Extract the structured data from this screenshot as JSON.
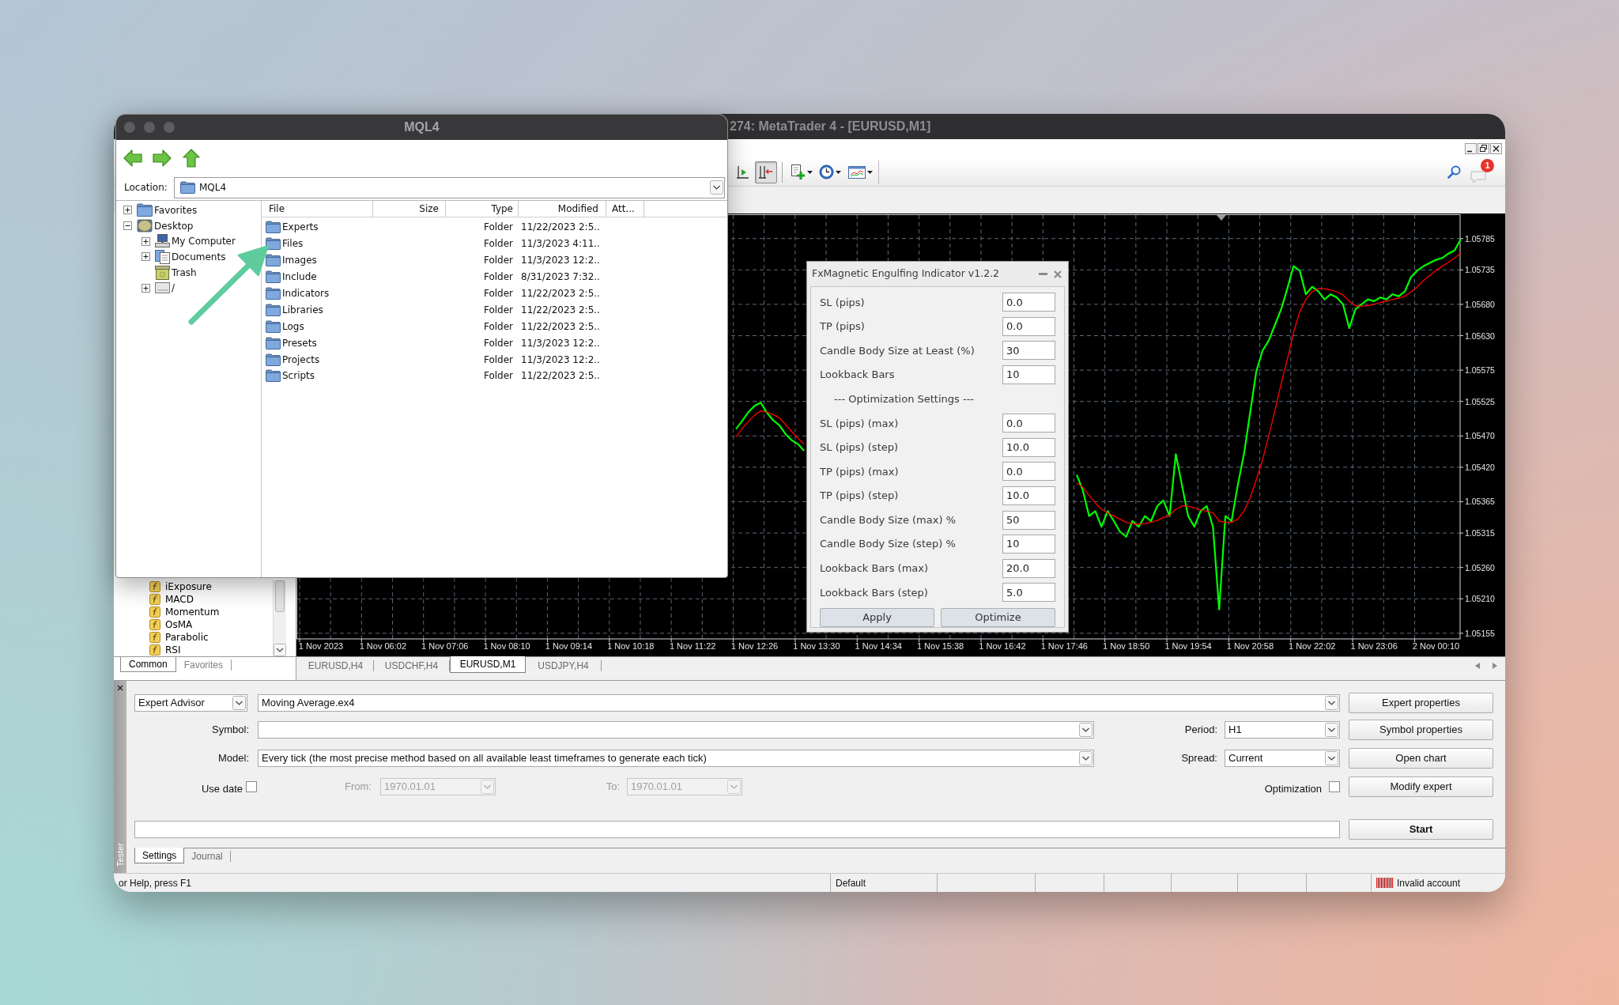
{
  "file_browser": {
    "title": "MQL4",
    "location_label": "Location:",
    "location": "MQL4",
    "tree": [
      {
        "kind": "favorites",
        "label": "Favorites",
        "expanded": false
      },
      {
        "kind": "desktop",
        "label": "Desktop",
        "expanded": true,
        "children": [
          {
            "kind": "computer",
            "label": "My Computer",
            "expanded": false
          },
          {
            "kind": "documents",
            "label": "Documents",
            "expanded": false
          },
          {
            "kind": "trash",
            "label": "Trash"
          },
          {
            "kind": "drive",
            "label": "/",
            "expanded": false
          }
        ]
      }
    ],
    "columns": [
      "File",
      "Size",
      "Type",
      "Modified",
      "Att..."
    ],
    "rows": [
      {
        "name": "Experts",
        "type": "Folder",
        "modified": "11/22/2023 2:5.."
      },
      {
        "name": "Files",
        "type": "Folder",
        "modified": "11/3/2023 4:11.."
      },
      {
        "name": "Images",
        "type": "Folder",
        "modified": "11/3/2023 12:2.."
      },
      {
        "name": "Include",
        "type": "Folder",
        "modified": "8/31/2023 7:32.."
      },
      {
        "name": "Indicators",
        "type": "Folder",
        "modified": "11/22/2023 2:5.."
      },
      {
        "name": "Libraries",
        "type": "Folder",
        "modified": "11/22/2023 2:5.."
      },
      {
        "name": "Logs",
        "type": "Folder",
        "modified": "11/22/2023 2:5.."
      },
      {
        "name": "Presets",
        "type": "Folder",
        "modified": "11/3/2023 12:2.."
      },
      {
        "name": "Projects",
        "type": "Folder",
        "modified": "11/3/2023 12:2.."
      },
      {
        "name": "Scripts",
        "type": "Folder",
        "modified": "11/22/2023 2:5.."
      }
    ]
  },
  "main_window": {
    "title": "274: MetaTrader 4 - [EURUSD,M1]"
  },
  "toolbar": {
    "buttons": [
      {
        "kind": "chart_shift",
        "pressed": false
      },
      {
        "kind": "auto_scroll",
        "pressed": true
      },
      {
        "kind": "separator"
      },
      {
        "kind": "new_chart",
        "pressed": false
      },
      {
        "kind": "periods",
        "pressed": false
      },
      {
        "kind": "templates",
        "pressed": false
      }
    ],
    "notification_count": "1"
  },
  "navigator": {
    "items": [
      "iExposure",
      "MACD",
      "Momentum",
      "OsMA",
      "Parabolic",
      "RSI"
    ],
    "tabs": [
      {
        "label": "Common",
        "selected": true
      },
      {
        "label": "Favorites",
        "selected": false
      }
    ]
  },
  "chart": {
    "chart_data": {
      "type": "line",
      "grid": true,
      "categories": [
        "1 Nov 2023",
        null,
        null,
        null,
        null,
        null,
        null,
        null,
        null,
        null,
        "1 Nov 06:02",
        null,
        null,
        null,
        null,
        null,
        null,
        null,
        null,
        null,
        "1 Nov 07:06",
        null,
        null,
        null,
        null,
        null,
        null,
        null,
        null,
        null,
        "1 Nov 08:10",
        null,
        null,
        null,
        null,
        null,
        null,
        null,
        null,
        null,
        "1 Nov 09:14",
        null,
        null,
        null,
        null,
        null,
        null,
        null,
        null,
        null,
        "1 Nov 10:18",
        null,
        null,
        null,
        null,
        null,
        null,
        null,
        null,
        null,
        "1 Nov 11:22",
        null,
        null,
        null,
        null,
        null,
        null,
        null,
        null,
        null,
        "1 Nov 12:26",
        null,
        null,
        null,
        null,
        null,
        null,
        null,
        null,
        null,
        "1 Nov 13:30",
        null,
        null,
        null,
        null,
        null,
        null,
        null,
        null,
        null,
        "1 Nov 14:34",
        null,
        null,
        null,
        null,
        null,
        null,
        null,
        null,
        null,
        "1 Nov 15:38",
        null,
        null,
        null,
        null,
        null,
        null,
        null,
        null,
        null,
        "1 Nov 16:42",
        null,
        null,
        null,
        null,
        null,
        null,
        null,
        null,
        null,
        "1 Nov 17:46",
        null,
        null,
        null,
        null,
        null,
        null,
        null,
        null,
        null,
        "1 Nov 18:50",
        null,
        null,
        null,
        null,
        null,
        null,
        null,
        null,
        null,
        "1 Nov 19:54",
        null,
        null,
        null,
        null,
        null,
        null,
        null,
        null,
        null,
        "1 Nov 20:58",
        null,
        null,
        null,
        null,
        null,
        null,
        null,
        null,
        null,
        "1 Nov 22:02",
        null,
        null,
        null,
        null,
        null,
        null,
        null,
        null,
        null,
        "1 Nov 23:06",
        null,
        null,
        null,
        null,
        null,
        null,
        null,
        null,
        null,
        "2 Nov 00:10",
        null,
        null,
        null,
        null
      ],
      "series": [
        {
          "color": "#00ff00",
          "values": [
            null,
            null,
            null,
            null,
            null,
            null,
            null,
            null,
            null,
            null,
            null,
            null,
            null,
            null,
            null,
            null,
            null,
            null,
            null,
            null,
            null,
            null,
            null,
            null,
            null,
            null,
            null,
            null,
            null,
            null,
            null,
            null,
            null,
            null,
            null,
            null,
            null,
            null,
            null,
            null,
            null,
            null,
            null,
            null,
            null,
            null,
            null,
            null,
            null,
            null,
            null,
            null,
            null,
            null,
            null,
            null,
            null,
            null,
            null,
            null,
            null,
            null,
            null,
            null,
            null,
            null,
            null,
            1.05481,
            1.05494,
            1.05508,
            1.05518,
            1.05523,
            1.05507,
            1.05495,
            1.05487,
            1.05473,
            1.05463,
            1.05457,
            1.05446,
            null,
            null,
            null,
            null,
            null,
            null,
            null,
            null,
            null,
            null,
            null,
            null,
            null,
            null,
            null,
            null,
            null,
            null,
            null,
            null,
            null,
            null,
            null,
            null,
            null,
            null,
            null,
            null,
            null,
            null,
            null,
            null,
            null,
            null,
            null,
            null,
            null,
            null,
            null,
            null,
            null,
            null,
            null,
            1.05408,
            1.05383,
            1.05342,
            1.0535,
            1.05325,
            1.0535,
            1.05334,
            1.05317,
            1.05309,
            1.05334,
            1.05325,
            1.05342,
            1.05334,
            1.05358,
            1.05367,
            1.05342,
            1.05441,
            1.05391,
            1.05342,
            1.05325,
            1.0535,
            1.05358,
            1.05325,
            1.05193,
            1.05342,
            1.05334,
            1.05391,
            1.05441,
            1.05507,
            1.05573,
            1.05606,
            1.05622,
            1.05647,
            1.05672,
            1.05705,
            1.05741,
            1.05734,
            1.05696,
            1.05708,
            1.05701,
            1.05688,
            1.05696,
            1.05691,
            1.0568,
            1.05642,
            1.05672,
            1.0568,
            1.05688,
            1.05685,
            1.05691,
            1.05688,
            1.05696,
            1.05693,
            1.05701,
            1.05724,
            1.05734,
            1.05741,
            1.05746,
            1.05751,
            1.05754,
            1.05761,
            1.05766,
            1.05784
          ]
        },
        {
          "color": "#ff0000",
          "values": [
            null,
            null,
            null,
            null,
            null,
            null,
            null,
            null,
            null,
            null,
            null,
            null,
            null,
            null,
            null,
            null,
            null,
            null,
            null,
            null,
            null,
            null,
            null,
            null,
            null,
            null,
            null,
            null,
            null,
            null,
            null,
            null,
            null,
            null,
            null,
            null,
            null,
            null,
            null,
            null,
            null,
            null,
            null,
            null,
            null,
            null,
            null,
            null,
            null,
            null,
            null,
            null,
            null,
            null,
            null,
            null,
            null,
            null,
            null,
            null,
            null,
            null,
            null,
            null,
            null,
            null,
            null,
            1.05468,
            1.05482,
            1.05493,
            1.05503,
            1.0551,
            1.05508,
            1.05504,
            1.05499,
            1.05488,
            1.05477,
            1.05466,
            1.05457,
            null,
            null,
            null,
            null,
            null,
            null,
            null,
            null,
            null,
            null,
            null,
            null,
            null,
            null,
            null,
            null,
            null,
            null,
            null,
            null,
            null,
            null,
            null,
            null,
            null,
            null,
            null,
            null,
            null,
            null,
            null,
            null,
            null,
            null,
            null,
            null,
            null,
            null,
            null,
            null,
            null,
            null,
            null,
            1.05395,
            1.05388,
            1.05375,
            1.05363,
            1.05353,
            1.05347,
            1.05342,
            1.05337,
            1.05332,
            1.0533,
            1.05329,
            1.0533,
            1.05332,
            1.05335,
            1.0534,
            1.05343,
            1.05353,
            1.05358,
            1.05358,
            1.05355,
            1.05352,
            1.0535,
            1.05347,
            1.05334,
            1.05332,
            1.05332,
            1.05337,
            1.0535,
            1.05371,
            1.054,
            1.05432,
            1.0547,
            1.0551,
            1.05553,
            1.05592,
            1.05635,
            1.05668,
            1.05688,
            1.057,
            1.05705,
            1.05705,
            1.05703,
            1.057,
            1.05695,
            1.05685,
            1.05678,
            1.05677,
            1.05678,
            1.0568,
            1.05683,
            1.05685,
            1.05688,
            1.0569,
            1.05693,
            1.057,
            1.05708,
            1.05718,
            1.05726,
            1.05734,
            1.05741,
            1.05747,
            1.05754,
            1.05762
          ]
        }
      ],
      "ylim": [
        1.05146,
        1.05825
      ],
      "yticks": [
        {
          "value": 1.05785,
          "label": "1.05785"
        },
        {
          "value": 1.05735,
          "label": "1.05735"
        },
        {
          "value": 1.0568,
          "label": "1.05680"
        },
        {
          "value": 1.0563,
          "label": "1.05630"
        },
        {
          "value": 1.05575,
          "label": "1.05575"
        },
        {
          "value": 1.05525,
          "label": "1.05525"
        },
        {
          "value": 1.0547,
          "label": "1.05470"
        },
        {
          "value": 1.0542,
          "label": "1.05420"
        },
        {
          "value": 1.05365,
          "label": "1.05365"
        },
        {
          "value": 1.05315,
          "label": "1.05315"
        },
        {
          "value": 1.0526,
          "label": "1.05260"
        },
        {
          "value": 1.0521,
          "label": "1.05210"
        },
        {
          "value": 1.05155,
          "label": "1.05155"
        }
      ]
    },
    "tabs": [
      {
        "label": "EURUSD,H4",
        "selected": false
      },
      {
        "label": "USDCHF,H4",
        "selected": false
      },
      {
        "label": "EURUSD,M1",
        "selected": true
      },
      {
        "label": "USDJPY,H4",
        "selected": false
      }
    ]
  },
  "indicator_dialog": {
    "title": "FxMagnetic Engulfing Indicator v1.2.2",
    "rows": [
      {
        "kind": "field",
        "label": "SL (pips)",
        "value": "0.0"
      },
      {
        "kind": "field",
        "label": "TP (pips)",
        "value": "0.0"
      },
      {
        "kind": "field",
        "label": "Candle Body Size at Least (%)",
        "value": "30"
      },
      {
        "kind": "field",
        "label": "Lookback Bars",
        "value": "10"
      },
      {
        "kind": "section",
        "label": "--- Optimization Settings ---"
      },
      {
        "kind": "field",
        "label": "SL (pips) (max)",
        "value": "0.0"
      },
      {
        "kind": "field",
        "label": "SL (pips) (step)",
        "value": "10.0"
      },
      {
        "kind": "field",
        "label": "TP (pips) (max)",
        "value": "0.0"
      },
      {
        "kind": "field",
        "label": "TP (pips) (step)",
        "value": "10.0"
      },
      {
        "kind": "field",
        "label": "Candle Body Size (max) %",
        "value": "50"
      },
      {
        "kind": "field",
        "label": "Candle Body Size (step) %",
        "value": "10"
      },
      {
        "kind": "field",
        "label": "Lookback Bars (max)",
        "value": "20.0"
      },
      {
        "kind": "field",
        "label": "Lookback Bars (step)",
        "value": "5.0"
      }
    ],
    "buttons": [
      "Apply",
      "Optimize"
    ]
  },
  "tester": {
    "panel_label": "Tester",
    "program_type": "Expert Advisor",
    "expert": "Moving Average.ex4",
    "symbol": {
      "label": "Symbol:"
    },
    "model": {
      "label": "Model:",
      "value": "Every tick (the most precise method based on all available least timeframes to generate each tick)"
    },
    "use_date": {
      "label": "Use date",
      "checked": false
    },
    "from": {
      "label": "From:",
      "value": "1970.01.01",
      "disabled": true
    },
    "to": {
      "label": "To:",
      "value": "1970.01.01",
      "disabled": true
    },
    "period": {
      "label": "Period:",
      "value": "H1"
    },
    "spread": {
      "label": "Spread:",
      "value": "Current"
    },
    "optimization": {
      "label": "Optimization",
      "checked": false
    },
    "side_buttons": [
      "Expert properties",
      "Symbol properties",
      "Open chart",
      "Modify expert"
    ],
    "progress": {
      "level": 0
    },
    "start_button": "Start",
    "tabs": [
      {
        "label": "Settings",
        "selected": true
      },
      {
        "label": "Journal",
        "selected": false
      }
    ]
  },
  "status_bar": {
    "help_text": "or Help, press F1",
    "profile": "Default",
    "account_status": "Invalid account"
  }
}
